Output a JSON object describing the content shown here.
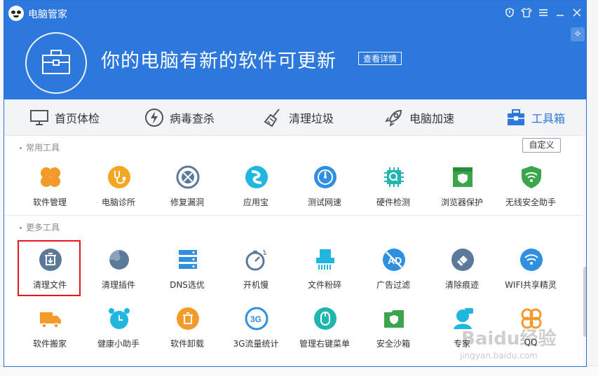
{
  "window": {
    "title": "电脑管家"
  },
  "header": {
    "message": "你的电脑有新的软件可更新",
    "detail_button": "查看详情"
  },
  "nav": [
    {
      "label": "首页体检",
      "icon": "monitor-icon"
    },
    {
      "label": "病毒查杀",
      "icon": "lightning-icon"
    },
    {
      "label": "清理垃圾",
      "icon": "broom-icon"
    },
    {
      "label": "电脑加速",
      "icon": "rocket-icon"
    },
    {
      "label": "工具箱",
      "icon": "toolbox-icon",
      "active": true
    }
  ],
  "sections": {
    "common_label": "常用工具",
    "more_label": "更多工具",
    "customize_button": "自定义"
  },
  "common_tools": [
    {
      "label": "软件管理",
      "icon": "clover-icon"
    },
    {
      "label": "电脑诊所",
      "icon": "stethoscope-icon"
    },
    {
      "label": "修复漏洞",
      "icon": "patch-icon"
    },
    {
      "label": "应用宝",
      "icon": "app-store-icon"
    },
    {
      "label": "测试网速",
      "icon": "speedometer-icon"
    },
    {
      "label": "硬件检测",
      "icon": "chip-icon"
    },
    {
      "label": "浏览器保护",
      "icon": "shield-icon"
    },
    {
      "label": "无线安全助手",
      "icon": "wifi-shield-icon"
    }
  ],
  "more_tools": [
    {
      "label": "清理文件",
      "icon": "trash-file-icon"
    },
    {
      "label": "清理插件",
      "icon": "puzzle-icon"
    },
    {
      "label": "DNS选优",
      "icon": "server-icon"
    },
    {
      "label": "开机慢",
      "icon": "stopwatch-icon"
    },
    {
      "label": "文件粉碎",
      "icon": "shredder-icon"
    },
    {
      "label": "广告过滤",
      "icon": "ad-block-icon"
    },
    {
      "label": "清除痕迹",
      "icon": "eraser-icon"
    },
    {
      "label": "WIFI共享精灵",
      "icon": "wifi-icon"
    },
    {
      "label": "软件搬家",
      "icon": "truck-icon"
    },
    {
      "label": "健康小助手",
      "icon": "alarm-clock-icon"
    },
    {
      "label": "软件卸载",
      "icon": "uninstall-icon"
    },
    {
      "label": "3G流量统计",
      "icon": "3g-icon"
    },
    {
      "label": "管理右键菜单",
      "icon": "mouse-icon"
    },
    {
      "label": "安全沙箱",
      "icon": "sandbox-icon"
    },
    {
      "label": "专家",
      "icon": "expert-icon"
    },
    {
      "label": "QQ",
      "icon": "qq-icon"
    }
  ],
  "watermark": {
    "brand": "Baidu经验",
    "url": "jingyan.baidu.com"
  },
  "colors": {
    "header_blue": "#2d78dd",
    "orange": "#f5a623",
    "steel": "#5b7a99",
    "cyan": "#1fb6e0",
    "green": "#3aa54a",
    "highlight": "#e4161e"
  }
}
